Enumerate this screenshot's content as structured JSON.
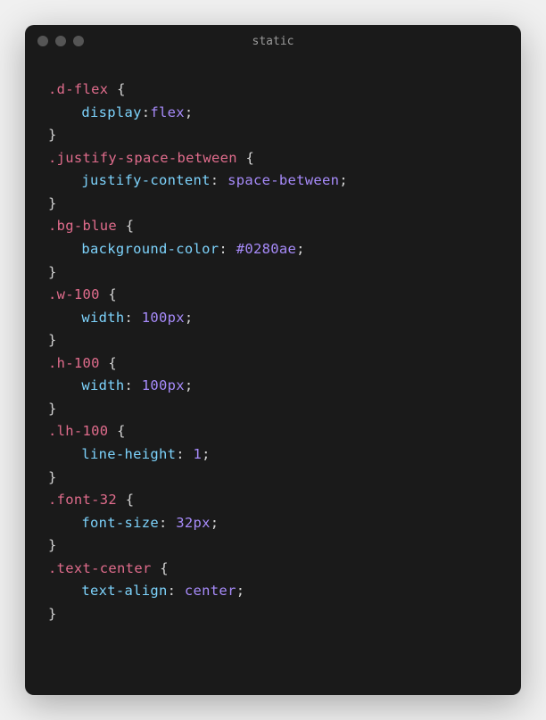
{
  "window": {
    "title": "static"
  },
  "colors": {
    "selector": "#e06c8c",
    "property": "#7dd3fc",
    "value": "#a78bfa",
    "punct": "#d4d4d4"
  },
  "code": {
    "rules": [
      {
        "selector": ".d-flex",
        "property": "display",
        "colon_space": false,
        "value": "flex"
      },
      {
        "selector": ".justify-space-between",
        "property": "justify-content",
        "colon_space": true,
        "value": "space-between"
      },
      {
        "selector": ".bg-blue",
        "property": "background-color",
        "colon_space": true,
        "value": "#0280ae"
      },
      {
        "selector": ".w-100",
        "property": "width",
        "colon_space": true,
        "value": "100px"
      },
      {
        "selector": ".h-100",
        "property": "width",
        "colon_space": true,
        "value": "100px"
      },
      {
        "selector": ".lh-100",
        "property": "line-height",
        "colon_space": true,
        "value": "1"
      },
      {
        "selector": ".font-32",
        "property": "font-size",
        "colon_space": true,
        "value": "32px"
      },
      {
        "selector": ".text-center",
        "property": "text-align",
        "colon_space": true,
        "value": "center"
      }
    ]
  }
}
